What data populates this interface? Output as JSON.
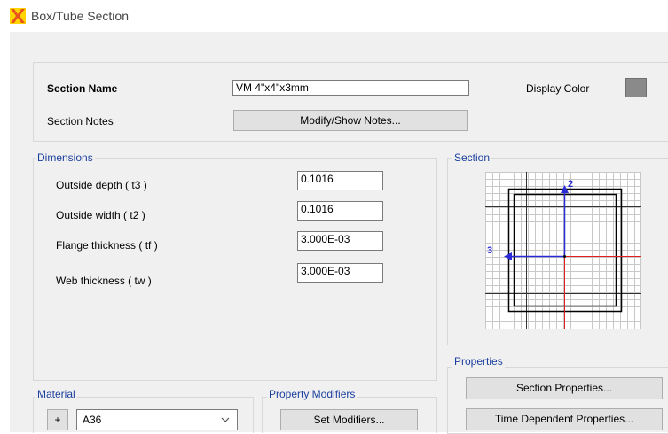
{
  "window": {
    "title": "Box/Tube Section",
    "icon": "app-cross-icon"
  },
  "section_name": {
    "label": "Section Name",
    "value": "VM 4\"x4\"x3mm"
  },
  "display_color": {
    "label": "Display Color",
    "color": "#8a8a8a"
  },
  "section_notes": {
    "label": "Section Notes",
    "button": "Modify/Show Notes..."
  },
  "dimensions": {
    "title": "Dimensions",
    "fields": [
      {
        "label": "Outside depth  ( t3 )",
        "value": "0.1016"
      },
      {
        "label": "Outside width  ( t2 )",
        "value": "0.1016"
      },
      {
        "label": "Flange thickness  ( tf )",
        "value": "3.000E-03"
      },
      {
        "label": "Web thickness  ( tw )",
        "value": "3.000E-03"
      }
    ]
  },
  "section_preview": {
    "title": "Section",
    "axis_vertical_label": "2",
    "axis_horizontal_label": "3",
    "colors": {
      "vertical_axis": "#2a2ad6",
      "horizontal_axis": "#2a2ad6",
      "red_axis": "#e02020",
      "grid": "#c8c8c8",
      "outline": "#000000"
    }
  },
  "properties": {
    "title": "Properties",
    "section_properties_button": "Section Properties...",
    "time_dependent_button": "Time Dependent Properties..."
  },
  "material": {
    "title": "Material",
    "add_button": "+",
    "selected": "A36"
  },
  "property_modifiers": {
    "title": "Property Modifiers",
    "button": "Set Modifiers..."
  }
}
